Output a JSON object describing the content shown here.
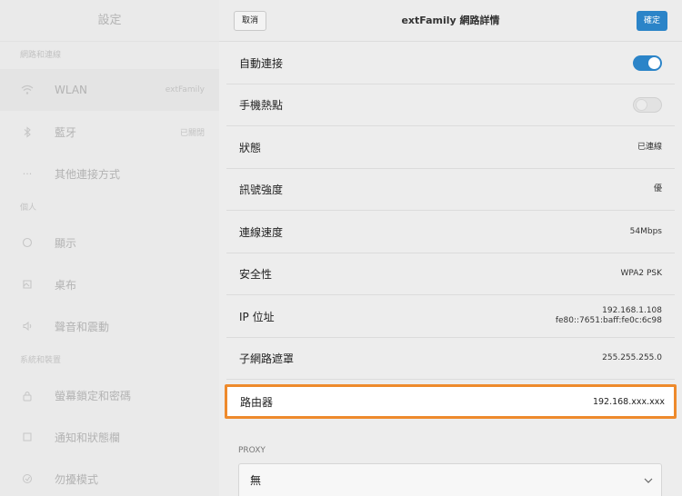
{
  "sidebar": {
    "title": "設定",
    "sections": [
      {
        "header": "網路和連線",
        "items": [
          {
            "label": "WLAN",
            "value": "extFamily",
            "icon": "wifi-icon",
            "active": true
          },
          {
            "label": "藍牙",
            "value": "已關閉",
            "icon": "bluetooth-icon"
          },
          {
            "label": "其他連接方式",
            "value": "",
            "icon": "more-icon"
          }
        ]
      },
      {
        "header": "個人",
        "items": [
          {
            "label": "顯示",
            "value": "",
            "icon": "display-icon"
          },
          {
            "label": "桌布",
            "value": "",
            "icon": "wallpaper-icon"
          },
          {
            "label": "聲音和震動",
            "value": "",
            "icon": "sound-icon"
          }
        ]
      },
      {
        "header": "系統和裝置",
        "items": [
          {
            "label": "螢幕鎖定和密碼",
            "value": "",
            "icon": "lock-icon"
          },
          {
            "label": "通知和狀態欄",
            "value": "",
            "icon": "notification-icon"
          },
          {
            "label": "勿擾模式",
            "value": "",
            "icon": "dnd-icon"
          }
        ]
      }
    ]
  },
  "nav": {
    "cancel_label": "取消",
    "title": "extFamily 網路詳情",
    "ok_label": "確定"
  },
  "details": {
    "auto_connect": {
      "label": "自動連接",
      "toggle": "on"
    },
    "hotspot": {
      "label": "手機熱點",
      "toggle": "off"
    },
    "status": {
      "label": "狀態",
      "value": "已連線"
    },
    "signal": {
      "label": "訊號強度",
      "value": "優"
    },
    "speed": {
      "label": "連線速度",
      "value": "54Mbps"
    },
    "security": {
      "label": "安全性",
      "value": "WPA2 PSK"
    },
    "ip": {
      "label": "IP 位址",
      "value_v4": "192.168.1.108",
      "value_v6": "fe80::7651:baff:fe0c:6c98"
    },
    "subnet": {
      "label": "子網路遮罩",
      "value": "255.255.255.0"
    },
    "router": {
      "label": "路由器",
      "value": "192.168.xxx.xxx"
    }
  },
  "proxy": {
    "label": "PROXY",
    "selected": "無"
  },
  "colors": {
    "accent": "#2b84c8",
    "highlight": "#ee8a2c"
  }
}
